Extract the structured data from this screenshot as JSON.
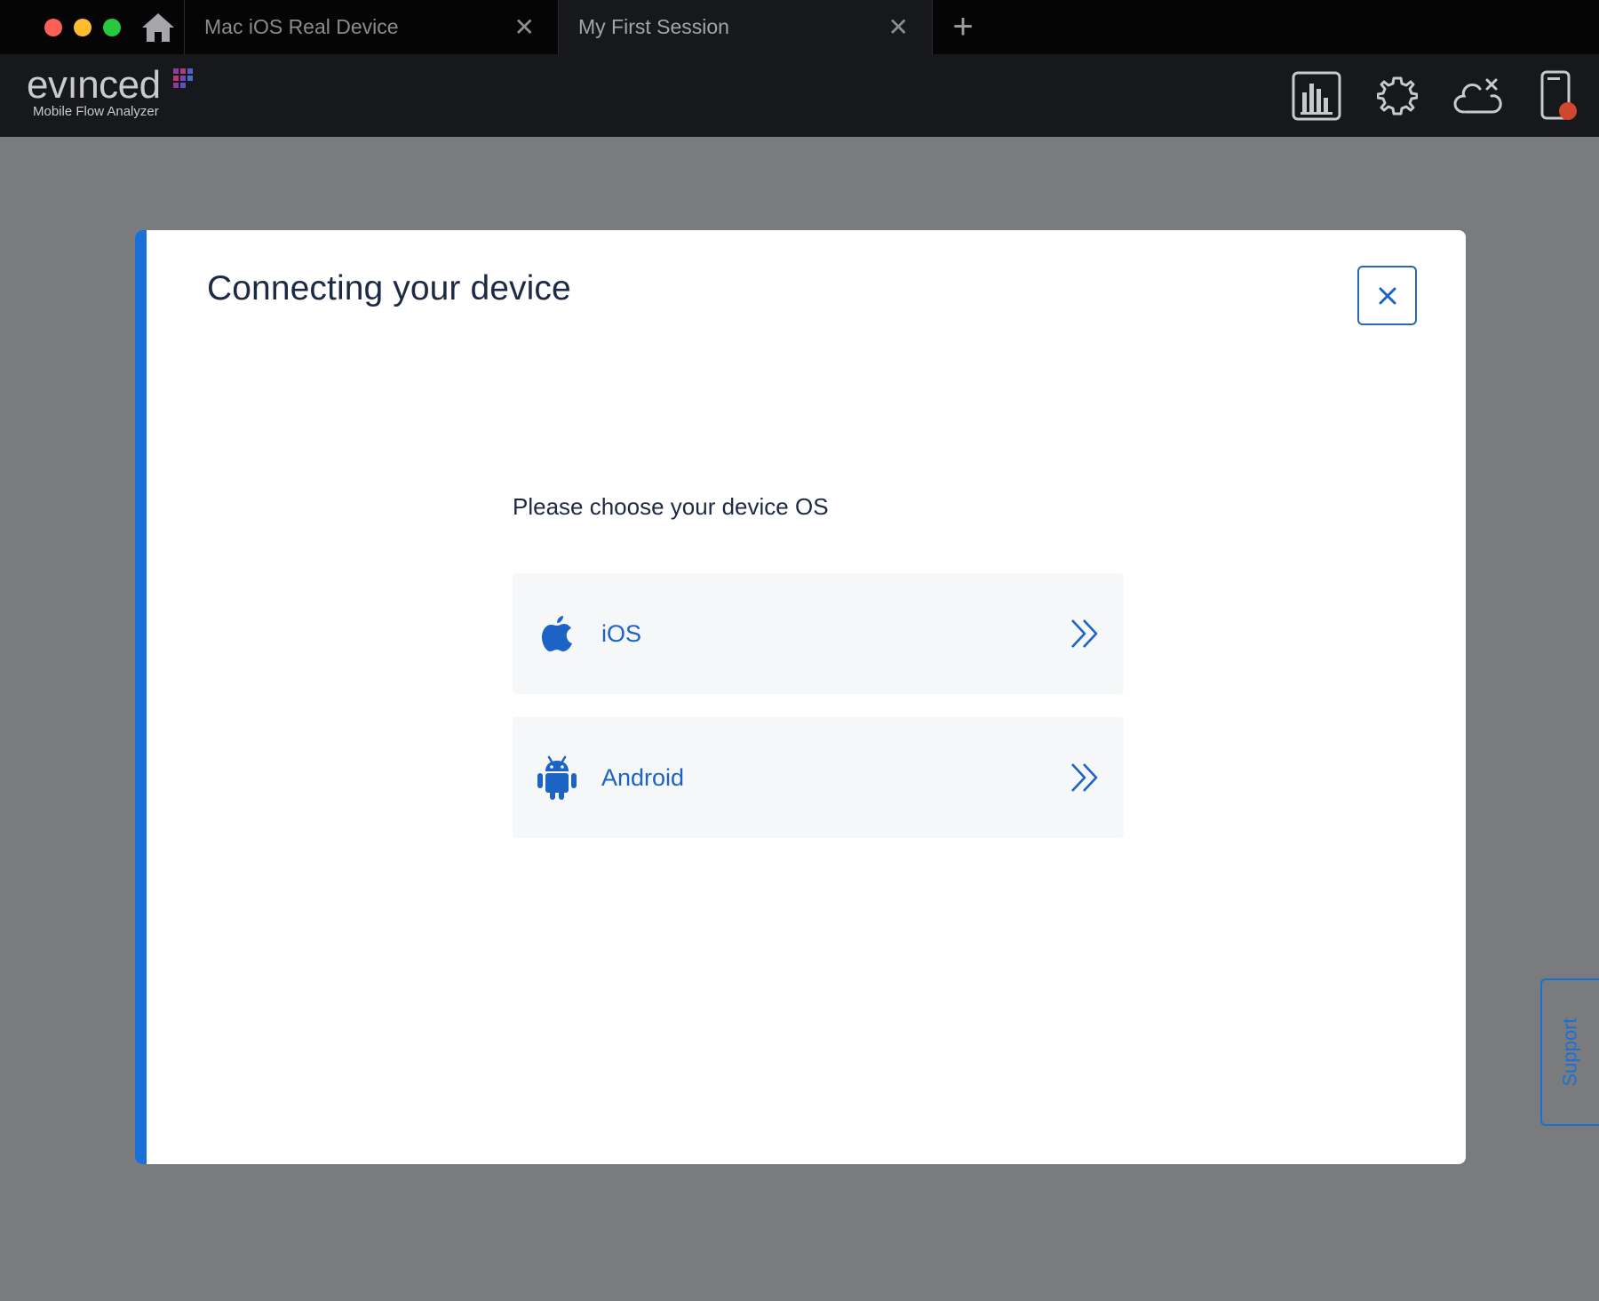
{
  "tabbar": {
    "tabs": [
      {
        "label": "Mac iOS Real Device",
        "active": false
      },
      {
        "label": "My First Session",
        "active": true
      }
    ],
    "close_glyph": "✕",
    "new_tab_glyph": "+"
  },
  "header": {
    "brand_name": "evınced",
    "brand_subtitle": "Mobile Flow Analyzer",
    "icons": [
      "report-chart-icon",
      "settings-gear-icon",
      "cloud-disconnected-icon",
      "device-recording-icon"
    ]
  },
  "modal": {
    "title": "Connecting your device",
    "close_glyph": "✕",
    "prompt": "Please choose your device OS",
    "options": [
      {
        "label": "iOS",
        "icon": "apple-icon"
      },
      {
        "label": "Android",
        "icon": "android-icon"
      }
    ]
  },
  "support": {
    "label": "Support"
  },
  "colors": {
    "accent": "#1a6fd8",
    "title_text": "#1d2a44",
    "option_text": "#1b63c4",
    "overlay": "#7a7b7d",
    "recording_dot": "#d0472d"
  }
}
